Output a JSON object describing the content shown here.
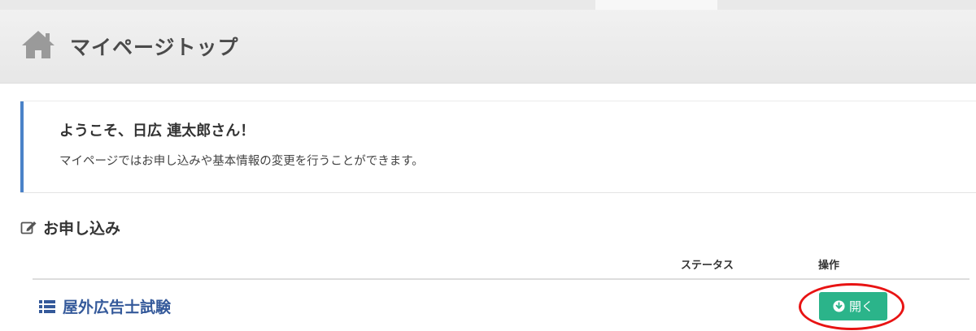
{
  "header": {
    "title": "マイページトップ",
    "icon": "home-icon"
  },
  "welcome": {
    "title": "ようこそ、日広 連太郎さん！",
    "message": "マイページではお申し込みや基本情報の変更を行うことができます。",
    "accent_color": "#4a82c8"
  },
  "applications": {
    "section_title": "お申し込み",
    "section_icon": "edit-icon",
    "columns": {
      "status": "ステータス",
      "action": "操作"
    },
    "rows": [
      {
        "name": "屋外広告士試験",
        "icon": "list-icon",
        "status": "",
        "action_label": "開く",
        "action_icon": "circle-arrow-down-icon"
      }
    ],
    "button_color": "#2bb48a",
    "highlight_color": "#e81313"
  }
}
